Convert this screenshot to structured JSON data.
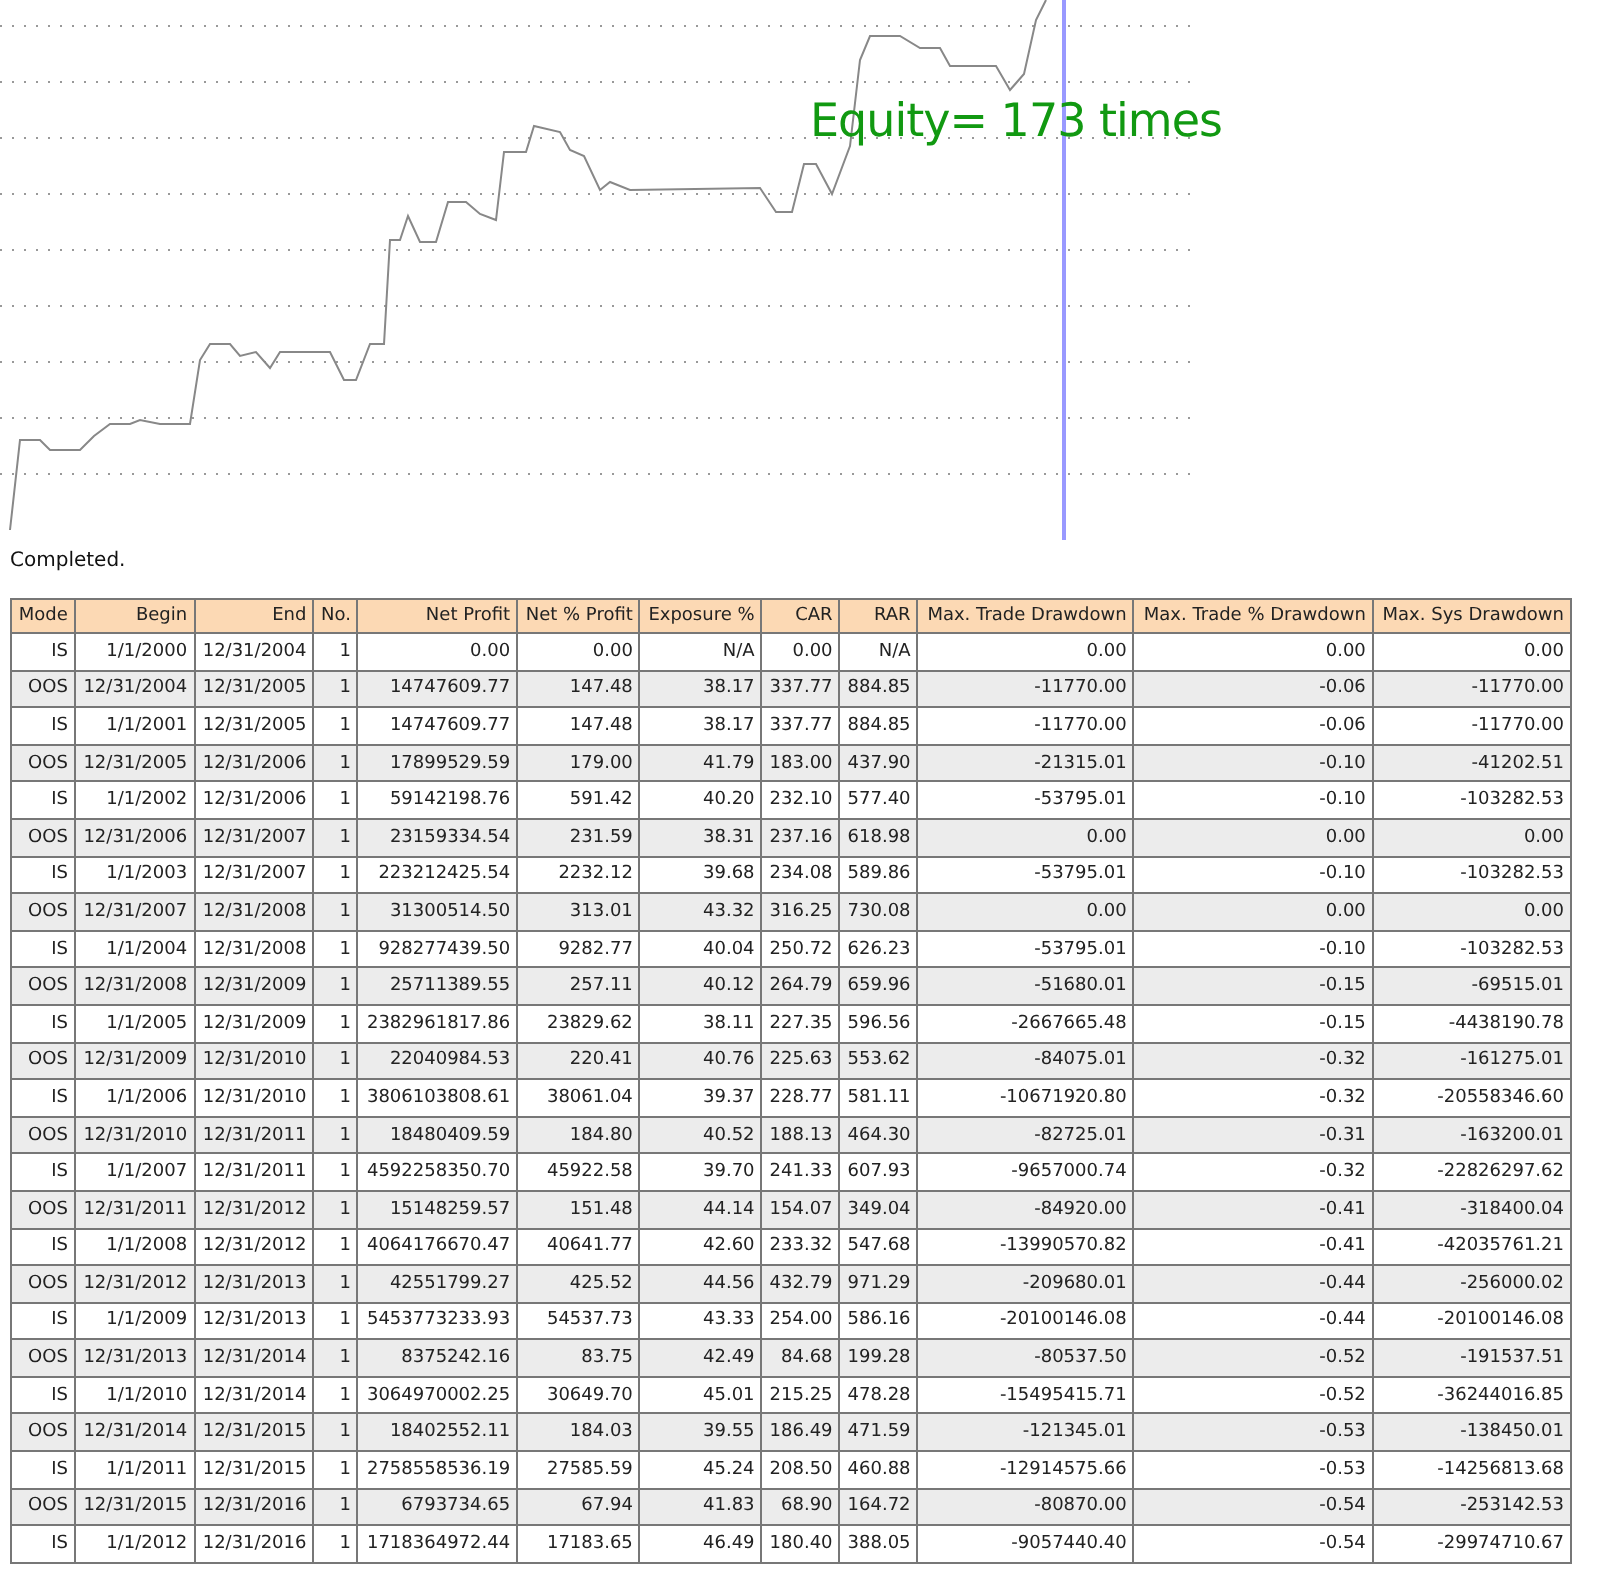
{
  "chart": {
    "label": "Equity= 173 times"
  },
  "status": "Completed.",
  "table": {
    "columns": [
      "Mode",
      "Begin",
      "End",
      "No.",
      "Net Profit",
      "Net % Profit",
      "Exposure %",
      "CAR",
      "RAR",
      "Max. Trade Drawdown",
      "Max. Trade % Drawdown",
      "Max. Sys Drawdown"
    ],
    "rows": [
      [
        "IS",
        "1/1/2000",
        "12/31/2004",
        "1",
        "0.00",
        "0.00",
        "N/A",
        "0.00",
        "N/A",
        "0.00",
        "0.00",
        "0.00"
      ],
      [
        "OOS",
        "12/31/2004",
        "12/31/2005",
        "1",
        "14747609.77",
        "147.48",
        "38.17",
        "337.77",
        "884.85",
        "-11770.00",
        "-0.06",
        "-11770.00"
      ],
      [
        "IS",
        "1/1/2001",
        "12/31/2005",
        "1",
        "14747609.77",
        "147.48",
        "38.17",
        "337.77",
        "884.85",
        "-11770.00",
        "-0.06",
        "-11770.00"
      ],
      [
        "OOS",
        "12/31/2005",
        "12/31/2006",
        "1",
        "17899529.59",
        "179.00",
        "41.79",
        "183.00",
        "437.90",
        "-21315.01",
        "-0.10",
        "-41202.51"
      ],
      [
        "IS",
        "1/1/2002",
        "12/31/2006",
        "1",
        "59142198.76",
        "591.42",
        "40.20",
        "232.10",
        "577.40",
        "-53795.01",
        "-0.10",
        "-103282.53"
      ],
      [
        "OOS",
        "12/31/2006",
        "12/31/2007",
        "1",
        "23159334.54",
        "231.59",
        "38.31",
        "237.16",
        "618.98",
        "0.00",
        "0.00",
        "0.00"
      ],
      [
        "IS",
        "1/1/2003",
        "12/31/2007",
        "1",
        "223212425.54",
        "2232.12",
        "39.68",
        "234.08",
        "589.86",
        "-53795.01",
        "-0.10",
        "-103282.53"
      ],
      [
        "OOS",
        "12/31/2007",
        "12/31/2008",
        "1",
        "31300514.50",
        "313.01",
        "43.32",
        "316.25",
        "730.08",
        "0.00",
        "0.00",
        "0.00"
      ],
      [
        "IS",
        "1/1/2004",
        "12/31/2008",
        "1",
        "928277439.50",
        "9282.77",
        "40.04",
        "250.72",
        "626.23",
        "-53795.01",
        "-0.10",
        "-103282.53"
      ],
      [
        "OOS",
        "12/31/2008",
        "12/31/2009",
        "1",
        "25711389.55",
        "257.11",
        "40.12",
        "264.79",
        "659.96",
        "-51680.01",
        "-0.15",
        "-69515.01"
      ],
      [
        "IS",
        "1/1/2005",
        "12/31/2009",
        "1",
        "2382961817.86",
        "23829.62",
        "38.11",
        "227.35",
        "596.56",
        "-2667665.48",
        "-0.15",
        "-4438190.78"
      ],
      [
        "OOS",
        "12/31/2009",
        "12/31/2010",
        "1",
        "22040984.53",
        "220.41",
        "40.76",
        "225.63",
        "553.62",
        "-84075.01",
        "-0.32",
        "-161275.01"
      ],
      [
        "IS",
        "1/1/2006",
        "12/31/2010",
        "1",
        "3806103808.61",
        "38061.04",
        "39.37",
        "228.77",
        "581.11",
        "-10671920.80",
        "-0.32",
        "-20558346.60"
      ],
      [
        "OOS",
        "12/31/2010",
        "12/31/2011",
        "1",
        "18480409.59",
        "184.80",
        "40.52",
        "188.13",
        "464.30",
        "-82725.01",
        "-0.31",
        "-163200.01"
      ],
      [
        "IS",
        "1/1/2007",
        "12/31/2011",
        "1",
        "4592258350.70",
        "45922.58",
        "39.70",
        "241.33",
        "607.93",
        "-9657000.74",
        "-0.32",
        "-22826297.62"
      ],
      [
        "OOS",
        "12/31/2011",
        "12/31/2012",
        "1",
        "15148259.57",
        "151.48",
        "44.14",
        "154.07",
        "349.04",
        "-84920.00",
        "-0.41",
        "-318400.04"
      ],
      [
        "IS",
        "1/1/2008",
        "12/31/2012",
        "1",
        "4064176670.47",
        "40641.77",
        "42.60",
        "233.32",
        "547.68",
        "-13990570.82",
        "-0.41",
        "-42035761.21"
      ],
      [
        "OOS",
        "12/31/2012",
        "12/31/2013",
        "1",
        "42551799.27",
        "425.52",
        "44.56",
        "432.79",
        "971.29",
        "-209680.01",
        "-0.44",
        "-256000.02"
      ],
      [
        "IS",
        "1/1/2009",
        "12/31/2013",
        "1",
        "5453773233.93",
        "54537.73",
        "43.33",
        "254.00",
        "586.16",
        "-20100146.08",
        "-0.44",
        "-20100146.08"
      ],
      [
        "OOS",
        "12/31/2013",
        "12/31/2014",
        "1",
        "8375242.16",
        "83.75",
        "42.49",
        "84.68",
        "199.28",
        "-80537.50",
        "-0.52",
        "-191537.51"
      ],
      [
        "IS",
        "1/1/2010",
        "12/31/2014",
        "1",
        "3064970002.25",
        "30649.70",
        "45.01",
        "215.25",
        "478.28",
        "-15495415.71",
        "-0.52",
        "-36244016.85"
      ],
      [
        "OOS",
        "12/31/2014",
        "12/31/2015",
        "1",
        "18402552.11",
        "184.03",
        "39.55",
        "186.49",
        "471.59",
        "-121345.01",
        "-0.53",
        "-138450.01"
      ],
      [
        "IS",
        "1/1/2011",
        "12/31/2015",
        "1",
        "2758558536.19",
        "27585.59",
        "45.24",
        "208.50",
        "460.88",
        "-12914575.66",
        "-0.53",
        "-14256813.68"
      ],
      [
        "OOS",
        "12/31/2015",
        "12/31/2016",
        "1",
        "6793734.65",
        "67.94",
        "41.83",
        "68.90",
        "164.72",
        "-80870.00",
        "-0.54",
        "-253142.53"
      ],
      [
        "IS",
        "1/1/2012",
        "12/31/2016",
        "1",
        "1718364972.44",
        "17183.65",
        "46.49",
        "180.40",
        "388.05",
        "-9057440.40",
        "-0.54",
        "-29974710.67"
      ]
    ]
  }
}
